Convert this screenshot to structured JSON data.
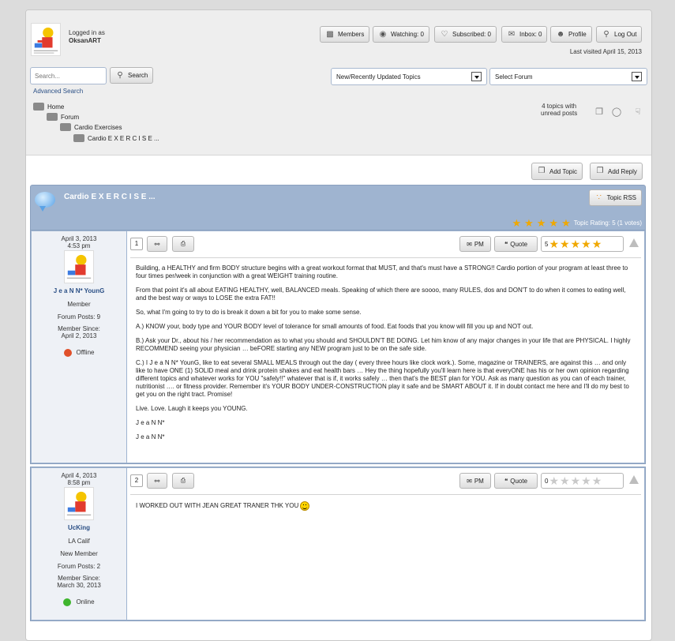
{
  "header": {
    "logged_in_as": "Logged in as",
    "username": "OksanART",
    "nav": {
      "members": "Members",
      "watching": "Watching: 0",
      "subscribed": "Subscribed: 0",
      "inbox": "Inbox: 0",
      "profile": "Profile",
      "logout": "Log Out"
    },
    "last_visited": "Last visited April 15, 2013"
  },
  "search": {
    "placeholder": "Search...",
    "button": "Search",
    "advanced": "Advanced Search"
  },
  "filters": {
    "topics_select": "New/Recently Updated Topics",
    "forum_select": "Select Forum"
  },
  "breadcrumb": [
    "Home",
    "Forum",
    "Cardio Exercises",
    "Cardio E X E R C I S E ..."
  ],
  "unread": {
    "line1": "4 topics with",
    "line2": "unread posts"
  },
  "actions": {
    "add_topic": "Add Topic",
    "add_reply": "Add Reply"
  },
  "topic": {
    "title": "Cardio E X E R C I S E ...",
    "rss": "Topic RSS",
    "rating_text": "Topic Rating: 5 (1 votes)",
    "rating_value": 5
  },
  "posts": [
    {
      "number": "1",
      "date": "April 3, 2013",
      "time": "4:53 pm",
      "author": "J e a N N* YounG",
      "role": "Member",
      "posts": "Forum Posts: 9",
      "member_since_label": "Member Since:",
      "member_since": "April 2, 2013",
      "status": "Offline",
      "status_color": "#e0502a",
      "pm": "PM",
      "quote": "Quote",
      "rating": "5",
      "stars_on": 5,
      "paragraphs": [
        "Building, a HEALTHY and firm BODY structure begins with a great workout format that MUST, and that's must have a STRONG!! Cardio portion of your program at least three to four times per/week in conjunction with a great WEIGHT training routine.",
        "From that point it's all about EATING HEALTHY, well, BALANCED meals. Speaking of which there are soooo, many RULES, dos and DON'T to do when it comes to eating well, and the best way or ways to LOSE the extra FAT!!",
        "So, what I'm going to try to do is break it down a bit for you to make some sense.",
        "A.) KNOW your, body type and YOUR BODY level of tolerance for small amounts of food. Eat foods that you know will fill you up and NOT out.",
        "B.) Ask your Dr., about his / her recommendation as to what you should and SHOULDN'T BE DOING. Let him know of any major changes in your life that are PHYSICAL. I highly RECOMMEND seeing your physician … beFORE starting any NEW program just to be on the safe side.",
        "C.) I J e a N N* YounG, like to eat several SMALL MEALS through out the day ( every three hours like clock work.). Some, magazine or TRAINERS, are against this … and only like to have ONE (1) SOLID meal and drink protein shakes and eat health bars … Hey the thing hopefully you'll learn here is that everyONE has his or her own opinion regarding different topics and whatever works for YOU \"safely!!\" whatever that is if, it works safely … then that's the BEST plan for YOU. Ask as many question as you can of each trainer, nutritionist …. or fitness provider. Remember it's YOUR BODY UNDER-CONSTRUCTION play it safe and be SMART ABOUT it. If in doubt contact me here and I'll do my best to get you on the right tract. Promise!",
        "Live. Love. Laugh it keeps you YOUNG.",
        "J e a N N*",
        "J e a N N*"
      ]
    },
    {
      "number": "2",
      "date": "April 4, 2013",
      "time": "8:58 pm",
      "author": "UcKing",
      "location": "LA Calif",
      "role": "New Member",
      "posts": "Forum Posts: 2",
      "member_since_label": "Member Since:",
      "member_since": "March 30, 2013",
      "status": "Online",
      "status_color": "#3fb52e",
      "pm": "PM",
      "quote": "Quote",
      "rating": "0",
      "stars_on": 0,
      "paragraphs": [
        "I WORKED OUT WITH JEAN GREAT TRANER THK YOU"
      ]
    }
  ]
}
